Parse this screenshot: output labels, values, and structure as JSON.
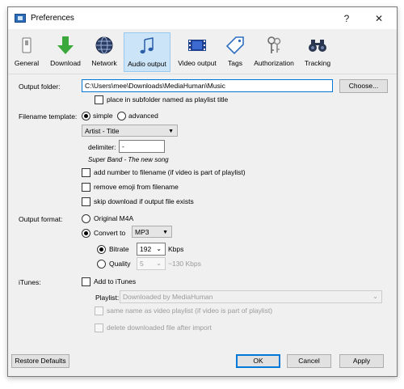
{
  "window": {
    "title": "Preferences",
    "help_btn": "?",
    "close_btn": "✕"
  },
  "toolbar": [
    {
      "label": "General",
      "icon": "switch-icon"
    },
    {
      "label": "Download",
      "icon": "download-arrow-icon"
    },
    {
      "label": "Network",
      "icon": "globe-icon"
    },
    {
      "label": "Audio output",
      "icon": "music-note-icon",
      "active": true
    },
    {
      "label": "Video output",
      "icon": "film-icon"
    },
    {
      "label": "Tags",
      "icon": "tag-icon"
    },
    {
      "label": "Authorization",
      "icon": "keys-icon"
    },
    {
      "label": "Tracking",
      "icon": "binoculars-icon"
    }
  ],
  "output_folder": {
    "label": "Output folder:",
    "value": "C:\\Users\\mee\\Downloads\\MediaHuman\\Music",
    "choose_btn": "Choose...",
    "subfolder_label": "place in subfolder named as playlist title"
  },
  "filename_template": {
    "label": "Filename template:",
    "simple_label": "simple",
    "advanced_label": "advanced",
    "selected": "Artist - Title",
    "delimiter_label": "delimiter:",
    "delimiter_value": "-",
    "example": "Super Band - The new song",
    "add_number_label": "add number to filename (if video is part of playlist)",
    "remove_emoji_label": "remove emoji from filename",
    "skip_download_label": "skip download if output file exists"
  },
  "output_format": {
    "label": "Output format:",
    "original_label": "Original M4A",
    "convert_label": "Convert to",
    "format_value": "MP3",
    "bitrate_label": "Bitrate",
    "bitrate_value": "192",
    "bitrate_unit": "Kbps",
    "quality_label": "Quality",
    "quality_value": "5",
    "quality_unit": "~130 Kbps"
  },
  "itunes": {
    "label": "iTunes:",
    "add_label": "Add to iTunes",
    "playlist_label": "Playlist:",
    "playlist_value": "Downloaded by MediaHuman",
    "same_name_label": "same name as video playlist (if video is part of playlist)",
    "delete_label": "delete downloaded file after import"
  },
  "footer": {
    "restore_btn": "Restore Defaults",
    "ok_btn": "OK",
    "cancel_btn": "Cancel",
    "apply_btn": "Apply"
  }
}
